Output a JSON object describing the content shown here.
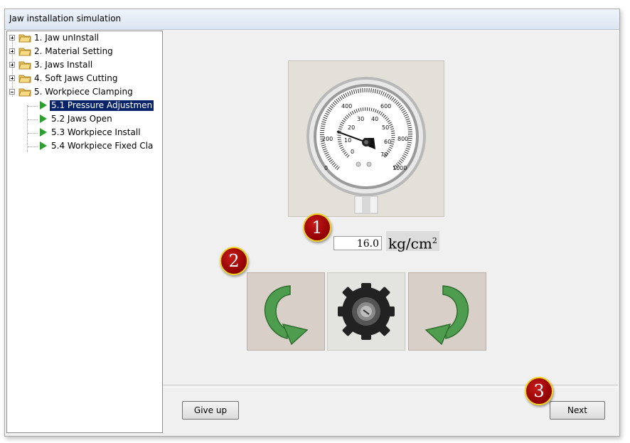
{
  "window": {
    "title": "Jaw installation simulation"
  },
  "tree": {
    "items": [
      {
        "label": "1. Jaw unInstall",
        "type": "folder",
        "expanded": false
      },
      {
        "label": "2. Material Setting",
        "type": "folder",
        "expanded": false
      },
      {
        "label": "3. Jaws Install",
        "type": "folder",
        "expanded": false
      },
      {
        "label": "4. Soft Jaws Cutting",
        "type": "folder",
        "expanded": false
      },
      {
        "label": "5. Workpiece Clamping",
        "type": "folder",
        "expanded": true
      },
      {
        "label": "5.1 Pressure Adjustmen",
        "type": "step",
        "selected": true
      },
      {
        "label": "5.2 Jaws Open",
        "type": "step"
      },
      {
        "label": "5.3 Workpiece Install",
        "type": "step"
      },
      {
        "label": "5.4 Workpiece Fixed Cla",
        "type": "step"
      }
    ]
  },
  "gauge": {
    "outer_scale": [
      "0",
      "200",
      "400",
      "600",
      "800",
      "1000"
    ],
    "inner_scale": [
      "0",
      "10",
      "20",
      "30",
      "40",
      "50",
      "60",
      "70"
    ]
  },
  "pressure": {
    "value": "16.0",
    "unit": "kg/cm",
    "unit_exp": "2"
  },
  "controls": {
    "rotate_left_icon": "rotate-counterclockwise-icon",
    "knob_icon": "knob-icon",
    "rotate_right_icon": "rotate-clockwise-icon"
  },
  "buttons": {
    "give_up": "Give up",
    "next": "Next"
  },
  "markers": {
    "m1": "1",
    "m2": "2",
    "m3": "3"
  },
  "colors": {
    "selection": "#0a246a",
    "arrow_green": "#4a9a4a",
    "marker_red": "#b00000"
  }
}
